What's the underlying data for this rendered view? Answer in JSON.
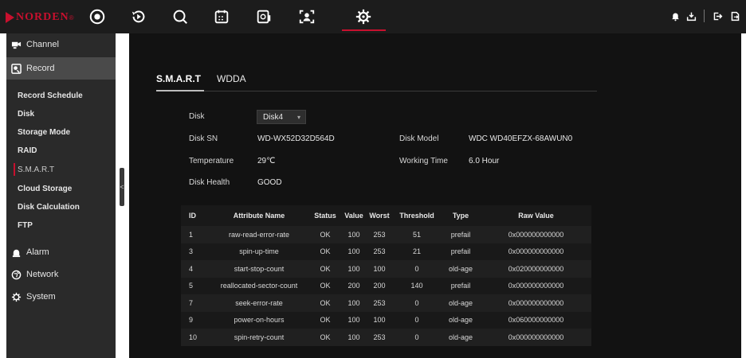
{
  "brand": {
    "name": "NORDEN",
    "mark": "®"
  },
  "colors": {
    "accent": "#c8102e",
    "topbar": "#1c1c1c",
    "sidebar": "#2a2a2a",
    "main": "#121212"
  },
  "topnav": [
    {
      "name": "live-view",
      "icon": "circle-target-icon"
    },
    {
      "name": "playback",
      "icon": "playback-icon"
    },
    {
      "name": "search",
      "icon": "search-icon"
    },
    {
      "name": "schedule",
      "icon": "calendar-icon"
    },
    {
      "name": "device-info",
      "icon": "device-icon"
    },
    {
      "name": "face-recognition",
      "icon": "face-scan-icon"
    },
    {
      "name": "settings",
      "icon": "gear-icon"
    }
  ],
  "topright_icons": [
    "bell-icon",
    "download-icon",
    "logout-icon",
    "export-icon"
  ],
  "sidebar": {
    "channel": "Channel",
    "record": "Record",
    "record_sub": [
      "Record Schedule",
      "Disk",
      "Storage Mode",
      "RAID",
      "S.M.A.R.T",
      "Cloud Storage",
      "Disk Calculation",
      "FTP"
    ],
    "alarm": "Alarm",
    "network": "Network",
    "system": "System",
    "collapse": "<"
  },
  "tabs": [
    "S.M.A.R.T",
    "WDDA"
  ],
  "disk": {
    "disk_label": "Disk",
    "disk_value": "Disk4",
    "sn_label": "Disk SN",
    "sn_value": "WD-WX52D32D564D",
    "model_label": "Disk Model",
    "model_value": "WDC WD40EFZX-68AWUN0",
    "temp_label": "Temperature",
    "temp_value": "29℃",
    "time_label": "Working Time",
    "time_value": "6.0 Hour",
    "health_label": "Disk Health",
    "health_value": "GOOD"
  },
  "table": {
    "headers": [
      "ID",
      "Attribute Name",
      "Status",
      "Value",
      "Worst",
      "Threshold",
      "Type",
      "Raw Value"
    ],
    "rows": [
      [
        "1",
        "raw-read-error-rate",
        "OK",
        "100",
        "253",
        "51",
        "prefail",
        "0x000000000000"
      ],
      [
        "3",
        "spin-up-time",
        "OK",
        "100",
        "253",
        "21",
        "prefail",
        "0x000000000000"
      ],
      [
        "4",
        "start-stop-count",
        "OK",
        "100",
        "100",
        "0",
        "old-age",
        "0x020000000000"
      ],
      [
        "5",
        "reallocated-sector-count",
        "OK",
        "200",
        "200",
        "140",
        "prefail",
        "0x000000000000"
      ],
      [
        "7",
        "seek-error-rate",
        "OK",
        "100",
        "253",
        "0",
        "old-age",
        "0x000000000000"
      ],
      [
        "9",
        "power-on-hours",
        "OK",
        "100",
        "100",
        "0",
        "old-age",
        "0x060000000000"
      ],
      [
        "10",
        "spin-retry-count",
        "OK",
        "100",
        "253",
        "0",
        "old-age",
        "0x000000000000"
      ]
    ]
  }
}
